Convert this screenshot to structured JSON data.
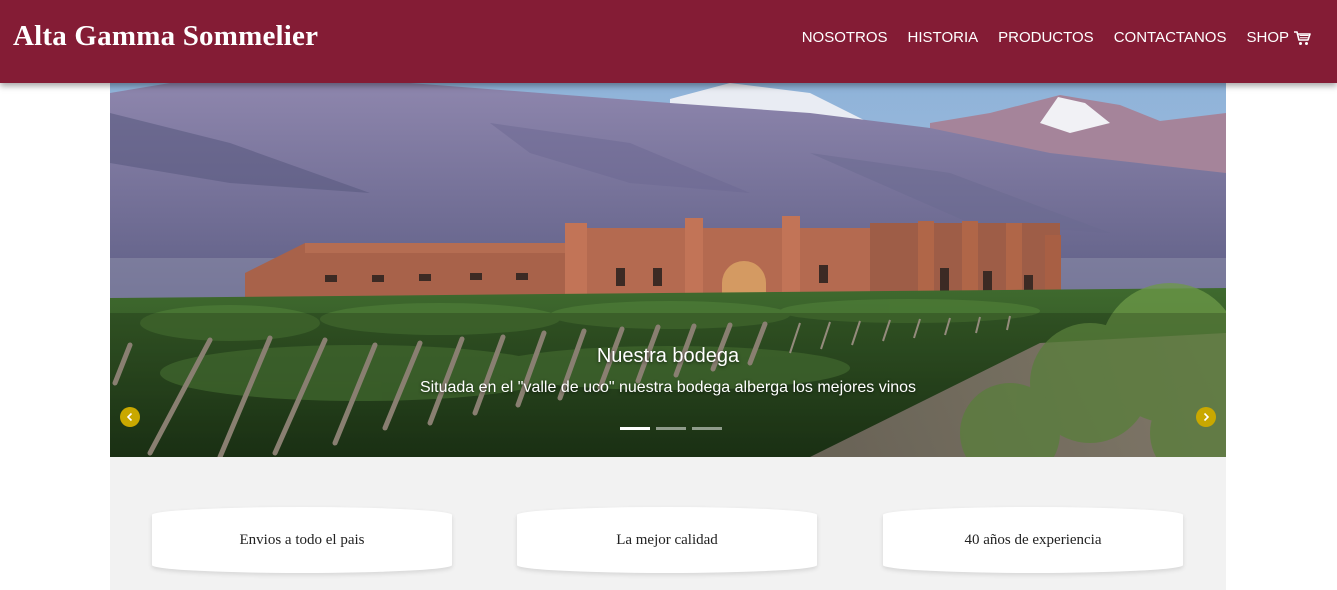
{
  "navbar": {
    "brand": "Alta Gamma Sommelier",
    "links": [
      "NOSOTROS",
      "HISTORIA",
      "PRODUCTOS",
      "CONTACTANOS",
      "SHOP"
    ],
    "shop_icon": "cart-icon",
    "background_color": "#841c35"
  },
  "carousel": {
    "slide": {
      "title": "Nuestra bodega",
      "text": "Situada en el \"valle de uco\" nuestra bodega alberga los mejores vinos"
    },
    "indicators": {
      "count": 3,
      "active_index": 0
    },
    "prev_icon": "chevron-left-icon",
    "next_icon": "chevron-right-icon",
    "control_color": "#c9a800"
  },
  "features": [
    {
      "text": "Envios a todo el pais"
    },
    {
      "text": "La mejor calidad"
    },
    {
      "text": "40 años de experiencia"
    }
  ]
}
